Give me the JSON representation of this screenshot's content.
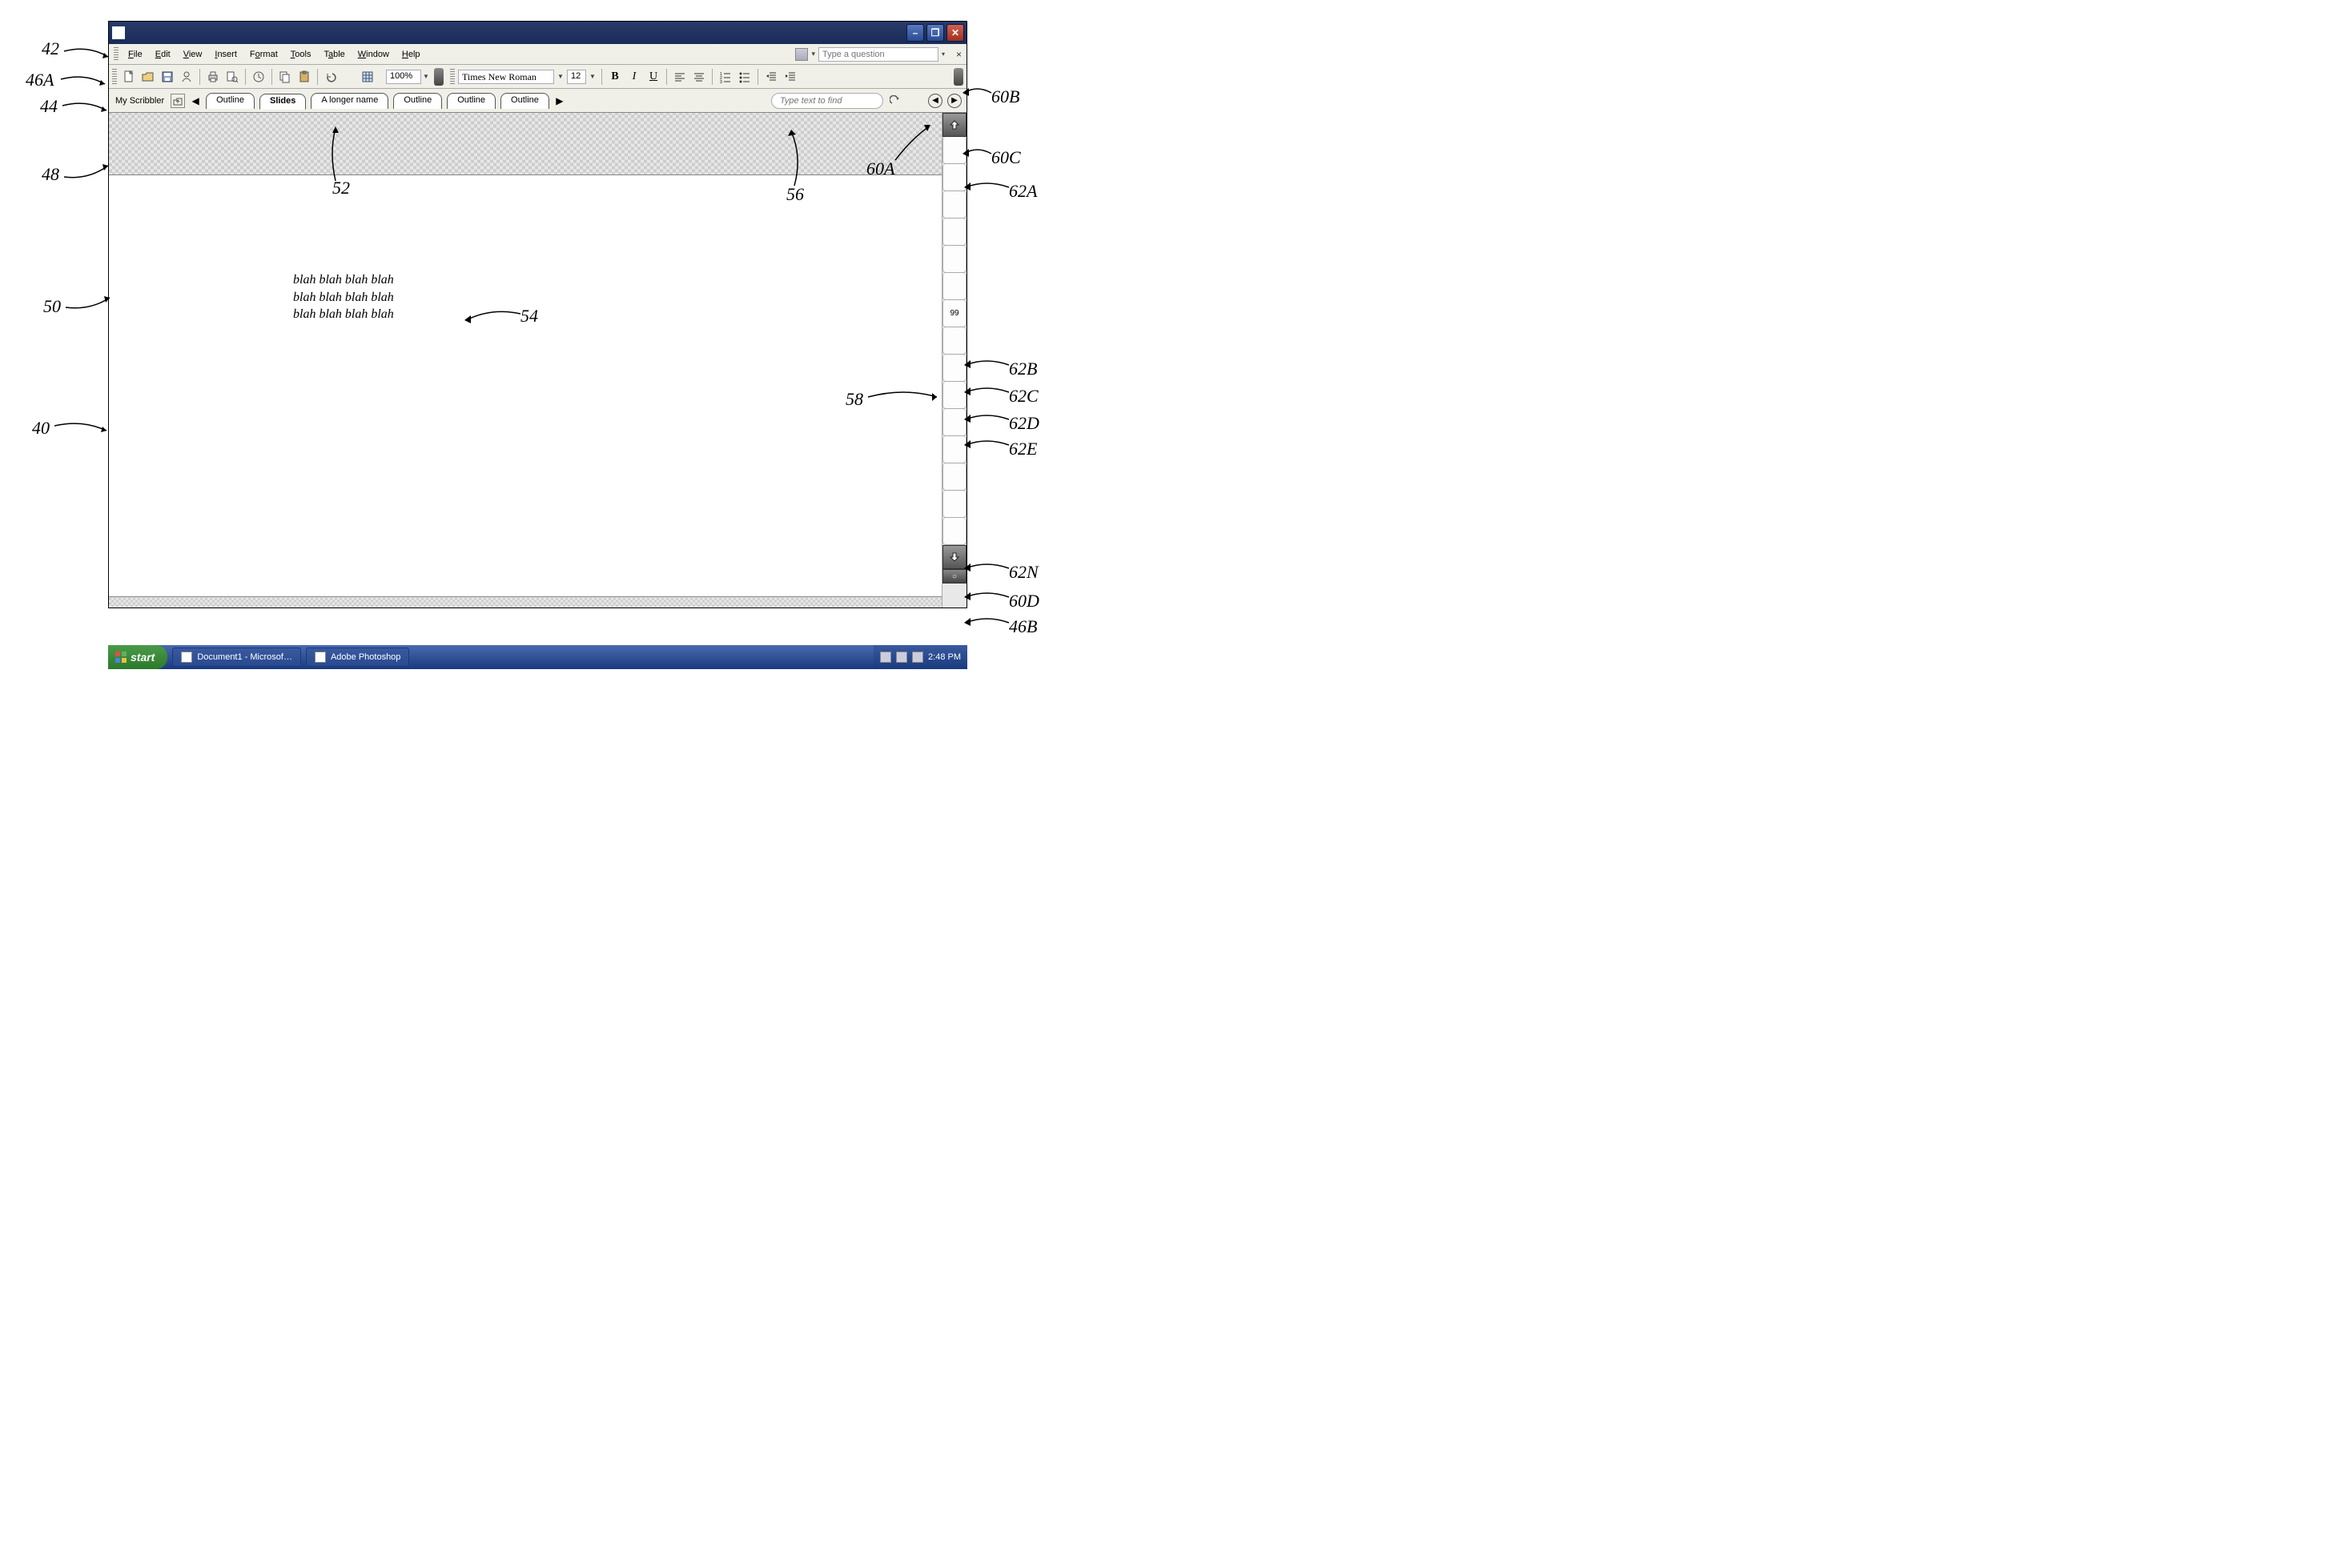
{
  "menu": {
    "items": [
      "File",
      "Edit",
      "View",
      "Insert",
      "Format",
      "Tools",
      "Table",
      "Window",
      "Help"
    ]
  },
  "help_box": {
    "placeholder": "Type a question",
    "dropdown": "▾",
    "close": "×"
  },
  "toolbar": {
    "zoom": "100%",
    "font": "Times New Roman",
    "size": "12",
    "bold": "B",
    "italic": "I",
    "underline": "U"
  },
  "tabbar": {
    "label": "My Scribbler",
    "tabs": [
      "Outline",
      "Slides",
      "A longer name",
      "Outline",
      "Outline",
      "Outline"
    ],
    "active_index": 1,
    "find_placeholder": "Type text to find"
  },
  "document": {
    "lines": [
      "blah blah blah blah",
      "blah blah blah blah",
      "blah blah blah blah"
    ]
  },
  "sidebar": {
    "cells": [
      "",
      "",
      "",
      "",
      "",
      "",
      "99",
      "",
      "",
      "",
      "",
      "",
      "",
      "",
      "",
      ""
    ]
  },
  "taskbar": {
    "start": "start",
    "items": [
      "Document1 - Microsof…",
      "Adobe Photoshop"
    ],
    "clock": "2:48 PM"
  },
  "callouts": {
    "c42": "42",
    "c46A": "46A",
    "c44": "44",
    "c48": "48",
    "c50": "50",
    "c40": "40",
    "c52": "52",
    "c54": "54",
    "c56": "56",
    "c58": "58",
    "c60A": "60A",
    "c60B": "60B",
    "c60C": "60C",
    "c60D": "60D",
    "c62A": "62A",
    "c62B": "62B",
    "c62C": "62C",
    "c62D": "62D",
    "c62E": "62E",
    "c62N": "62N",
    "c46B": "46B"
  }
}
